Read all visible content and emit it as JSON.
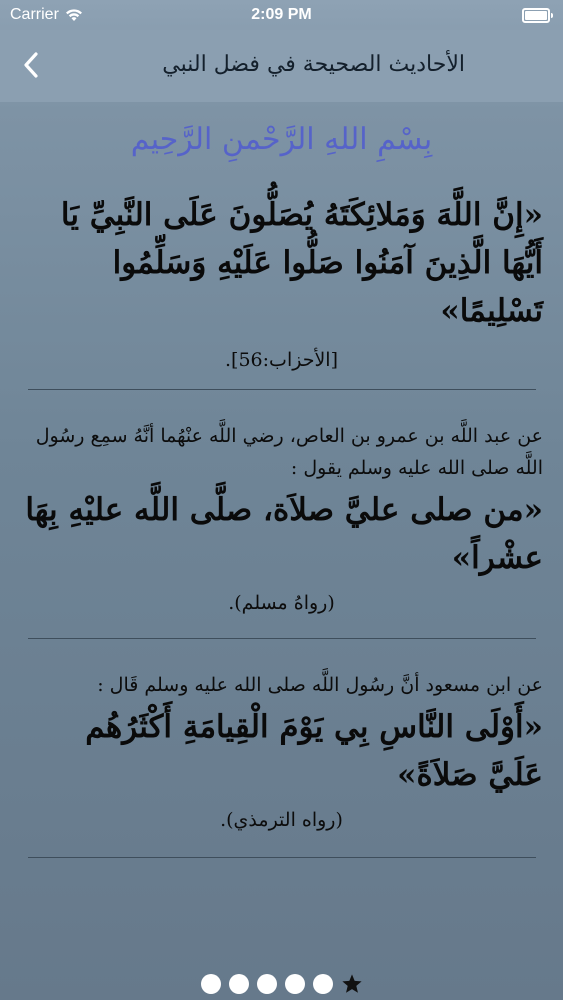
{
  "status_bar": {
    "carrier": "Carrier",
    "time": "2:09 PM"
  },
  "nav": {
    "title": "الأحاديث الصحيحة في فضل النبي",
    "back_icon": "chevron-left-icon"
  },
  "basmala": "بِسْمِ اللهِ الرَّحْمنِ الرَّحِيم",
  "sections": [
    {
      "quote": "«إِنَّ اللَّهَ وَمَلائِكَتَهُ يُصَلُّونَ عَلَى النَّبِيِّ يَا أَيُّهَا الَّذِينَ آمَنُوا صَلُّوا عَلَيْهِ وَسَلِّمُوا تَسْلِيمًا»",
      "reference": "[الأحزاب:56]."
    },
    {
      "intro": "عن عبد اللَّه بن عمرو بن العاص، رضي اللَّه عنْهُما أنَّهُ سمِع رسُول اللَّه صلى الله عليه وسلم يقول :",
      "quote": "«من صلى عليَّ صلاَة، صلَّى اللَّه عليْهِ بِهَا عشْراً»",
      "reference": "(رواهُ مسلم)."
    },
    {
      "intro": "عن ابن مسعود أنَّ رسُول اللَّه صلى الله عليه وسلم قَال :",
      "quote": "«أَوْلَى النَّاسِ بِي يَوْمَ الْقِيامَةِ أَكْثَرُهُم عَلَيَّ صَلاَةً»",
      "reference": "(رواه الترمذي)."
    }
  ],
  "page_control": {
    "pages": 6,
    "current": 0,
    "current_icon": "star-icon"
  },
  "colors": {
    "nav_bg": "#8b9fb1",
    "basmala": "#5663c9",
    "text": "#0a0a0a",
    "divider": "#3e4e5c"
  }
}
